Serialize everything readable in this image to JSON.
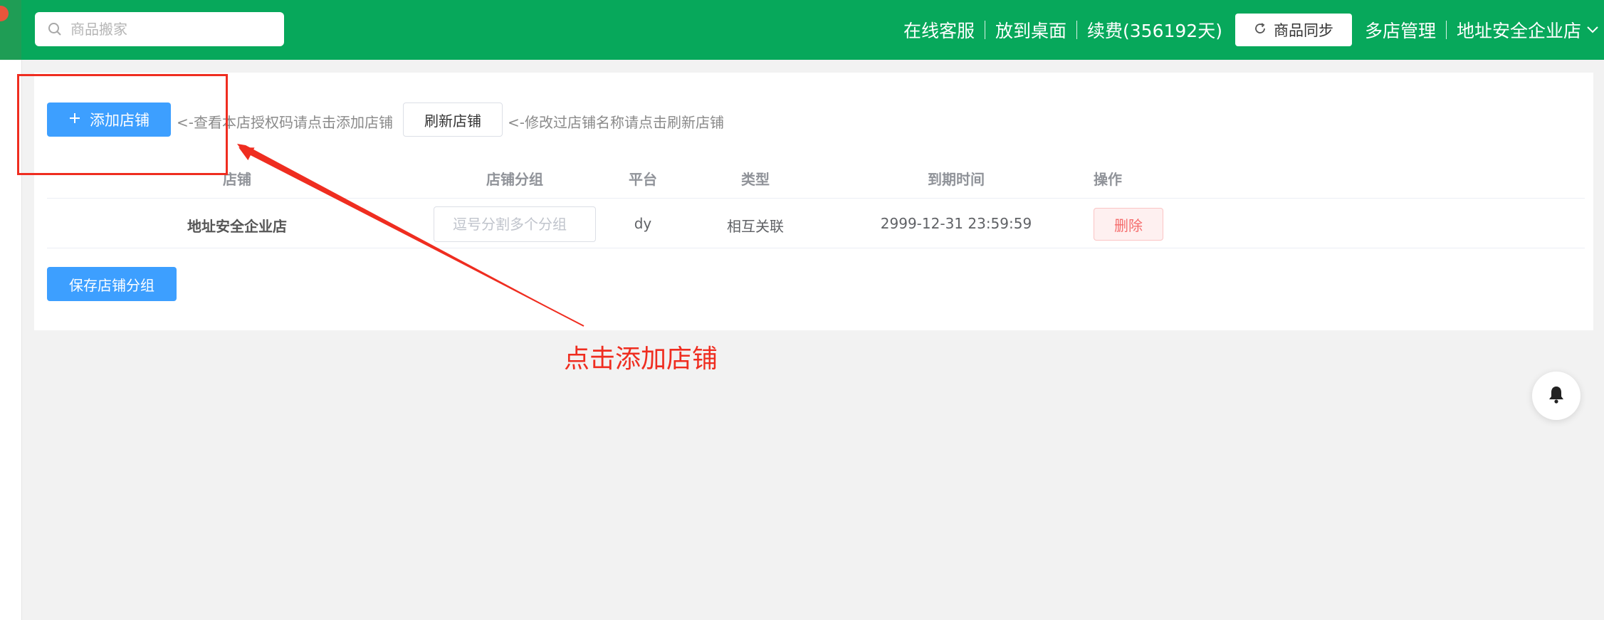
{
  "header": {
    "search_placeholder": "商品搬家",
    "links": {
      "support": "在线客服",
      "desktop": "放到桌面",
      "renew": "续费(356192天)",
      "sync": "商品同步",
      "multi_store": "多店管理",
      "current_store": "地址安全企业店"
    },
    "bar_color": "#07a85b"
  },
  "toolbar": {
    "add_store": "添加店铺",
    "add_hint": "<-查看本店授权码请点击添加店铺",
    "refresh_store": "刷新店铺",
    "refresh_hint": "<-修改过店铺名称请点击刷新店铺"
  },
  "table": {
    "columns": [
      "店铺",
      "店铺分组",
      "平台",
      "类型",
      "到期时间",
      "操作"
    ],
    "rows": [
      {
        "store": "地址安全企业店",
        "group_placeholder": "逗号分割多个分组",
        "platform": "dy",
        "type": "相互关联",
        "expiry": "2999-12-31 23:59:59",
        "action": "删除"
      }
    ]
  },
  "save_groups": "保存店铺分组",
  "annotation": {
    "text": "点击添加店铺",
    "color": "#ef2d20"
  },
  "icons": {
    "search": "search-icon",
    "refresh": "refresh-icon",
    "plus": "plus-icon",
    "bell": "bell-icon",
    "chevron": "chevron-down-icon"
  }
}
